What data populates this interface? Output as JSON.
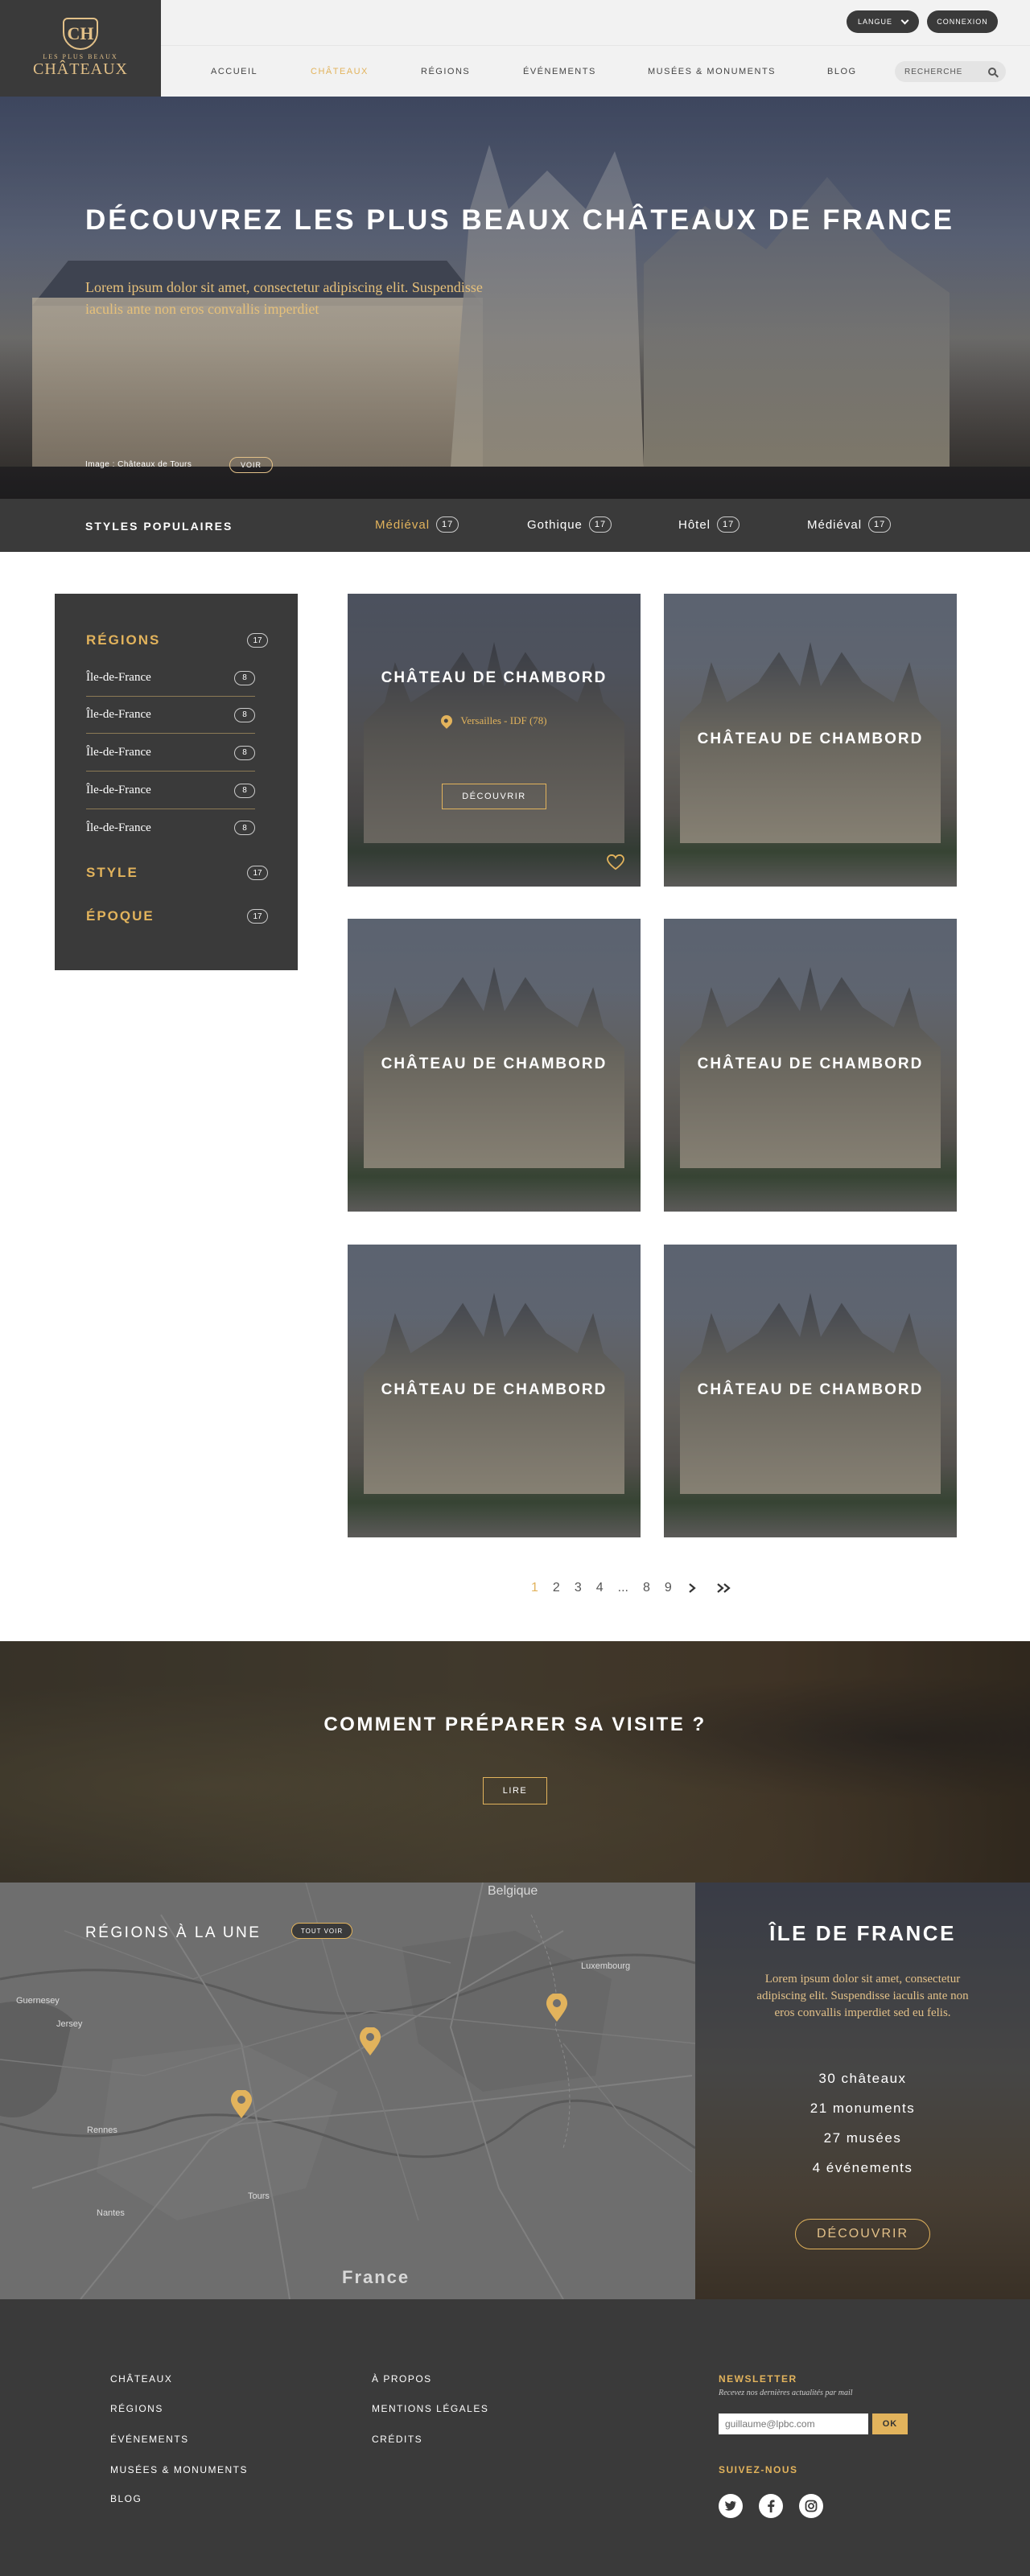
{
  "header": {
    "logo_small": "LES PLUS BEAUX",
    "logo_big": "CHÂTEAUX",
    "logo_letters": "CH",
    "lang_label": "LANGUE",
    "login_label": "CONNEXION",
    "nav": [
      "ACCUEIL",
      "CHÂTEAUX",
      "RÉGIONS",
      "ÉVÉNEMENTS",
      "MUSÉES & MONUMENTS",
      "BLOG"
    ],
    "active_nav": "CHÂTEAUX",
    "search_placeholder": "RECHERCHE"
  },
  "hero": {
    "title": "DÉCOUVREZ LES PLUS BEAUX CHÂTEAUX DE FRANCE",
    "text": "Lorem ipsum dolor sit amet, consectetur adipiscing elit. Suspendisse iaculis ante non eros convallis imperdiet",
    "caption": "Image : Châteaux de Tours",
    "voir": "VOIR"
  },
  "popular": {
    "title": "STYLES POPULAIRES",
    "items": [
      {
        "label": "Médiéval",
        "count": "17",
        "active": true
      },
      {
        "label": "Gothique",
        "count": "17",
        "active": false
      },
      {
        "label": "Hôtel",
        "count": "17",
        "active": false
      },
      {
        "label": "Médiéval",
        "count": "17",
        "active": false
      }
    ]
  },
  "sidebar": {
    "regions": {
      "label": "RÉGIONS",
      "count": "17"
    },
    "items": [
      {
        "label": "Île-de-France",
        "count": "8"
      },
      {
        "label": "Île-de-France",
        "count": "8"
      },
      {
        "label": "Île-de-France",
        "count": "8"
      },
      {
        "label": "Île-de-France",
        "count": "8"
      },
      {
        "label": "Île-de-France",
        "count": "8"
      }
    ],
    "style": {
      "label": "STYLE",
      "count": "17"
    },
    "epoque": {
      "label": "ÉPOQUE",
      "count": "17"
    }
  },
  "cards": {
    "titles": [
      "CHÂTEAU DE CHAMBORD",
      "CHÂTEAU DE CHAMBORD",
      "CHÂTEAU DE CHAMBORD",
      "CHÂTEAU DE CHAMBORD",
      "CHÂTEAU DE CHAMBORD",
      "CHÂTEAU DE CHAMBORD"
    ],
    "featured_location": "Versailles - IDF (78)",
    "featured_button": "DÉCOUVRIR"
  },
  "pagination": {
    "pages": [
      "1",
      "2",
      "3",
      "4",
      "...",
      "8",
      "9"
    ],
    "active": "1"
  },
  "visit": {
    "title": "COMMENT PRÉPARER SA VISITE ?",
    "button": "LIRE"
  },
  "regions": {
    "title": "RÉGIONS À LA UNE",
    "tout_voir": "TOUT VOIR",
    "map_labels": {
      "belgique": "Belgique",
      "luxembourg": "Luxembourg",
      "guernesey": "Guernesey",
      "jersey": "Jersey",
      "rennes": "Rennes",
      "nantes": "Nantes",
      "tours": "Tours",
      "france": "France"
    },
    "feature": {
      "title": "ÎLE DE FRANCE",
      "text": "Lorem ipsum dolor sit amet, consectetur adipiscing elit. Suspendisse iaculis ante non eros convallis imperdiet sed eu felis.",
      "stats": [
        "30 châteaux",
        "21 monuments",
        "27 musées",
        "4 événements"
      ],
      "button": "DÉCOUVRIR"
    }
  },
  "footer": {
    "col1": [
      "CHÂTEAUX",
      "RÉGIONS",
      "ÉVÉNEMENTS",
      "MUSÉES & MONUMENTS",
      "BLOG"
    ],
    "col2": [
      "À PROPOS",
      "MENTIONS LÉGALES",
      "CRÉDITS"
    ],
    "newsletter_title": "NEWSLETTER",
    "newsletter_sub": "Recevez nos dernières actualités par mail",
    "newsletter_value": "guillaume@lpbc.com",
    "newsletter_button": "OK",
    "follow_title": "SUIVEZ-NOUS"
  },
  "colors": {
    "accent": "#e2b35c",
    "dark": "#3a3a3a",
    "light": "#f2f2f2"
  }
}
